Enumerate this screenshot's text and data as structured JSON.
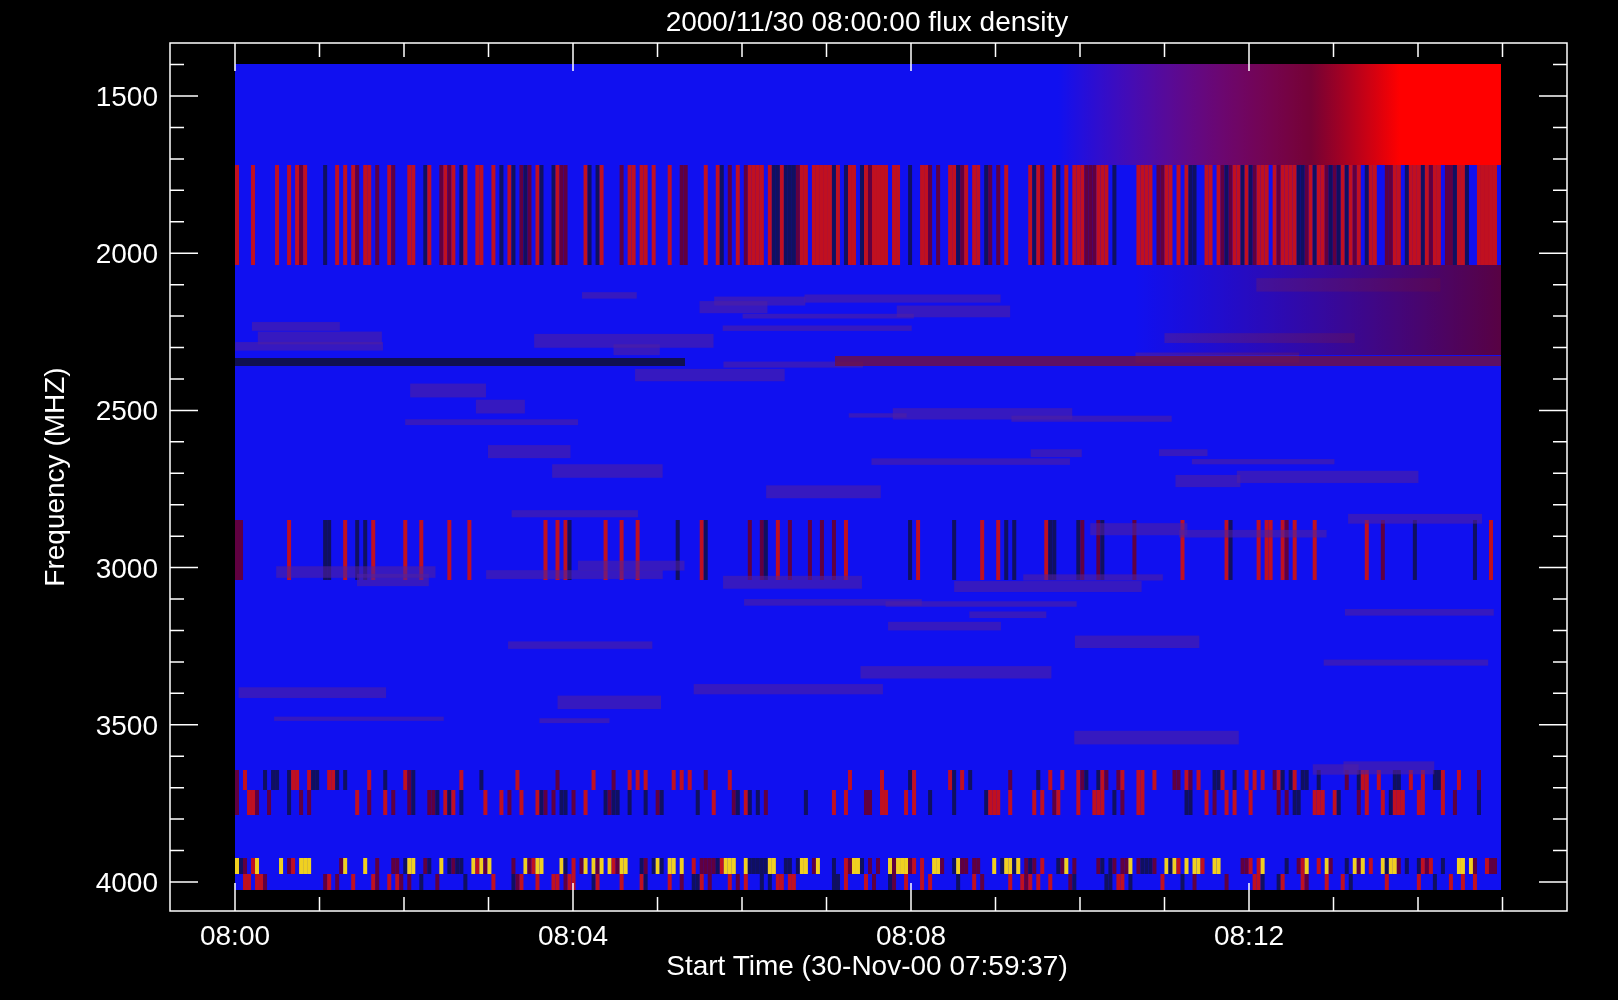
{
  "chart": {
    "title": "2000/11/30 08:00:00 flux density",
    "y_axis": {
      "title": "Frequency (MHZ)",
      "ticks": [
        "1500",
        "2000",
        "2500",
        "3000",
        "3500",
        "4000"
      ]
    },
    "x_axis": {
      "title": "Start Time (30-Nov-00 07:59:37)",
      "ticks": [
        "08:00",
        "08:04",
        "08:08",
        "08:12"
      ]
    }
  }
}
